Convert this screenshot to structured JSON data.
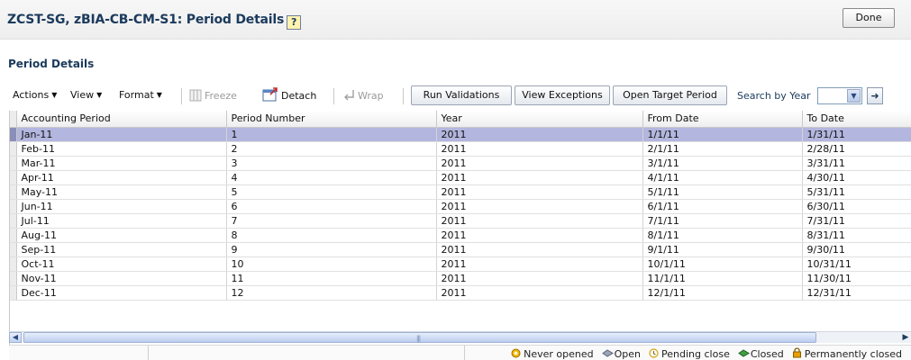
{
  "page": {
    "title": "ZCST-SG, zBIA-CB-CM-S1: Period Details",
    "help_icon_text": "?",
    "done_label": "Done"
  },
  "section": {
    "title": "Period Details"
  },
  "toolbar": {
    "actions_label": "Actions",
    "view_label": "View",
    "format_label": "Format",
    "freeze_label": "Freeze",
    "detach_label": "Detach",
    "wrap_label": "Wrap",
    "run_validations_label": "Run Validations",
    "view_exceptions_label": "View Exceptions",
    "open_target_period_label": "Open Target Period",
    "search_by_year_label": "Search by Year",
    "year_value": ""
  },
  "table": {
    "columns": [
      "Accounting Period",
      "Period Number",
      "Year",
      "From Date",
      "To Date"
    ],
    "selected_row": 0,
    "rows": [
      [
        "Jan-11",
        "1",
        "2011",
        "1/1/11",
        "1/31/11"
      ],
      [
        "Feb-11",
        "2",
        "2011",
        "2/1/11",
        "2/28/11"
      ],
      [
        "Mar-11",
        "3",
        "2011",
        "3/1/11",
        "3/31/11"
      ],
      [
        "Apr-11",
        "4",
        "2011",
        "4/1/11",
        "4/30/11"
      ],
      [
        "May-11",
        "5",
        "2011",
        "5/1/11",
        "5/31/11"
      ],
      [
        "Jun-11",
        "6",
        "2011",
        "6/1/11",
        "6/30/11"
      ],
      [
        "Jul-11",
        "7",
        "2011",
        "7/1/11",
        "7/31/11"
      ],
      [
        "Aug-11",
        "8",
        "2011",
        "8/1/11",
        "8/31/11"
      ],
      [
        "Sep-11",
        "9",
        "2011",
        "9/1/11",
        "9/30/11"
      ],
      [
        "Oct-11",
        "10",
        "2011",
        "10/1/11",
        "10/31/11"
      ],
      [
        "Nov-11",
        "11",
        "2011",
        "11/1/11",
        "11/30/11"
      ],
      [
        "Dec-11",
        "12",
        "2011",
        "12/1/11",
        "12/31/11"
      ]
    ]
  },
  "legend": [
    {
      "label": "Never opened",
      "icon": "never-opened-icon",
      "color": "#f0b400"
    },
    {
      "label": "Open",
      "icon": "open-icon",
      "color": "#9aa6b8"
    },
    {
      "label": "Pending close",
      "icon": "pending-close-icon",
      "color": "#d4b030"
    },
    {
      "label": "Closed",
      "icon": "closed-icon",
      "color": "#3fa040"
    },
    {
      "label": "Permanently closed",
      "icon": "permanently-closed-icon",
      "color": "#e8a000"
    }
  ],
  "colors": {
    "title": "#1b3a5c",
    "selected_row": "#b3b6de"
  }
}
